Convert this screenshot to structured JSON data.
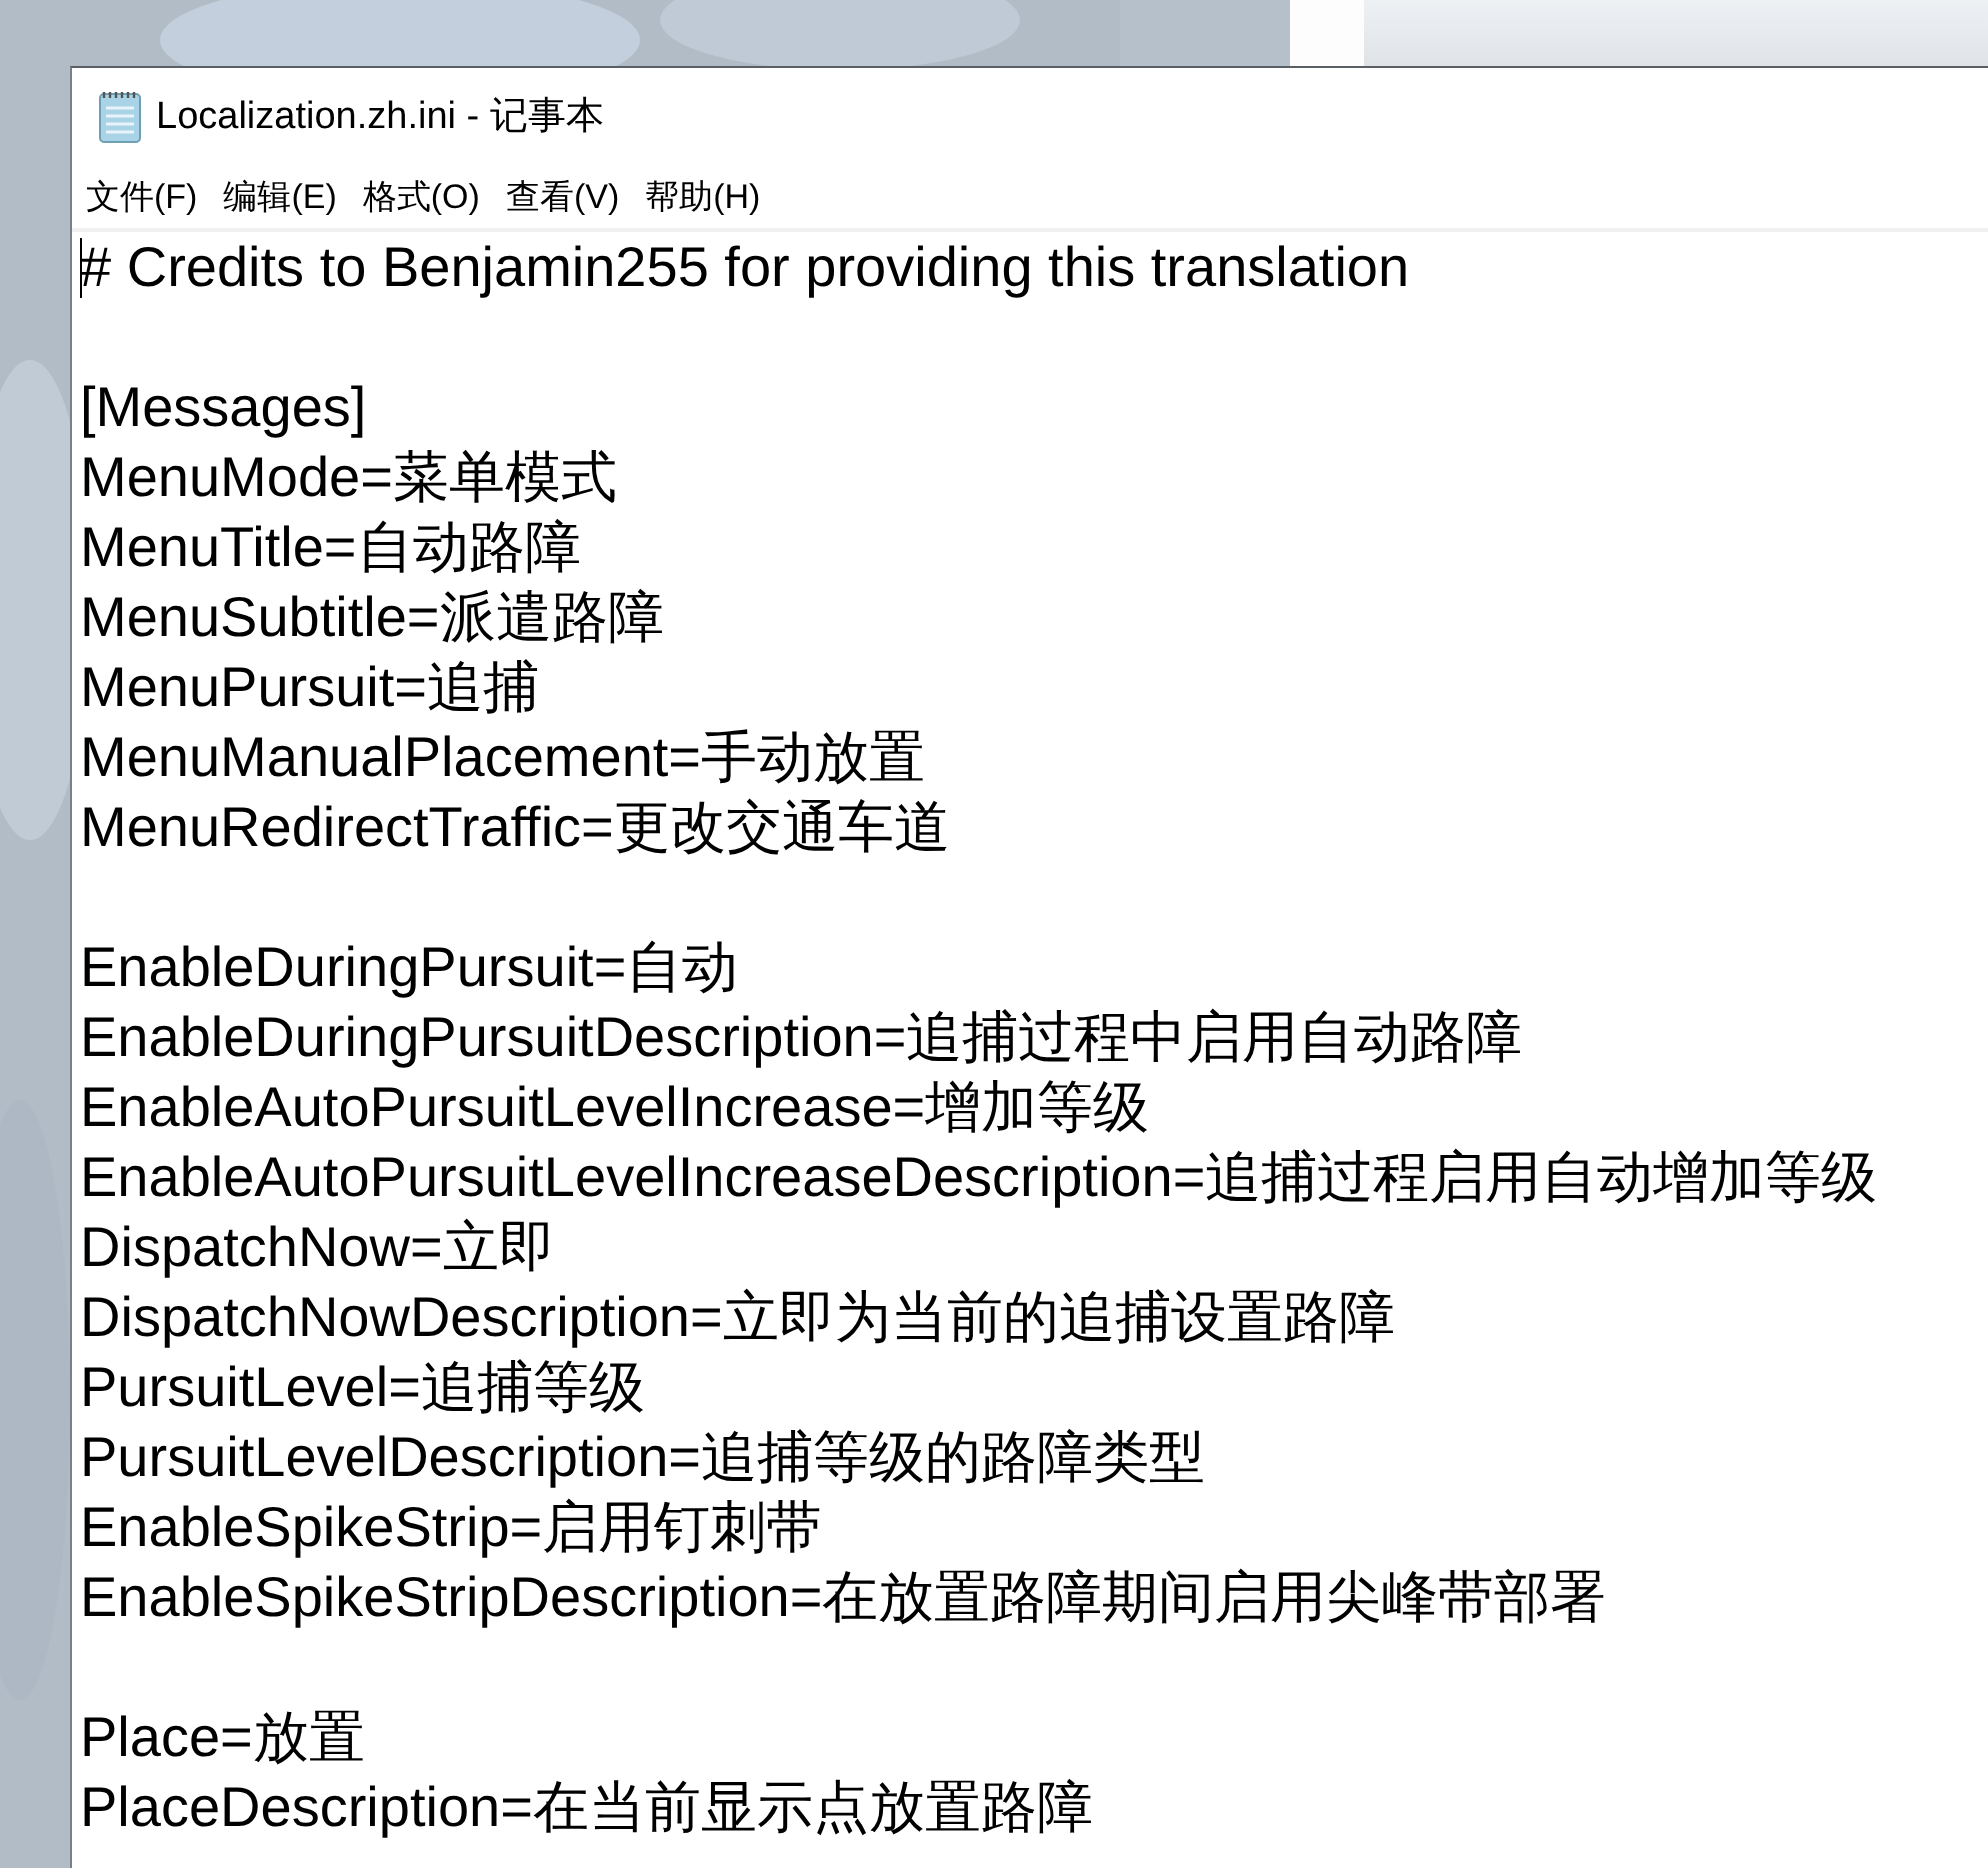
{
  "window": {
    "title": "Localization.zh.ini - 记事本"
  },
  "menu": [
    {
      "label": "文件(F)"
    },
    {
      "label": "编辑(E)"
    },
    {
      "label": "格式(O)"
    },
    {
      "label": "查看(V)"
    },
    {
      "label": "帮助(H)"
    }
  ],
  "editor": {
    "caret": true,
    "lines": [
      {
        "kind": "text",
        "text": "# Credits to Benjamin255 for providing this translation"
      },
      {
        "kind": "blank"
      },
      {
        "kind": "text",
        "text": "[Messages]"
      },
      {
        "kind": "text",
        "text": "MenuMode=菜单模式"
      },
      {
        "kind": "text",
        "text": "MenuTitle=自动路障"
      },
      {
        "kind": "text",
        "text": "MenuSubtitle=派遣路障"
      },
      {
        "kind": "text",
        "text": "MenuPursuit=追捕"
      },
      {
        "kind": "text",
        "text": "MenuManualPlacement=手动放置"
      },
      {
        "kind": "text",
        "text": "MenuRedirectTraffic=更改交通车道"
      },
      {
        "kind": "blank"
      },
      {
        "kind": "text",
        "text": "EnableDuringPursuit=自动"
      },
      {
        "kind": "text",
        "text": "EnableDuringPursuitDescription=追捕过程中启用自动路障"
      },
      {
        "kind": "text",
        "text": "EnableAutoPursuitLevelIncrease=增加等级"
      },
      {
        "kind": "text",
        "text": "EnableAutoPursuitLevelIncreaseDescription=追捕过程启用自动增加等级"
      },
      {
        "kind": "text",
        "text": "DispatchNow=立即"
      },
      {
        "kind": "text",
        "text": "DispatchNowDescription=立即为当前的追捕设置路障"
      },
      {
        "kind": "text",
        "text": "PursuitLevel=追捕等级"
      },
      {
        "kind": "text",
        "text": "PursuitLevelDescription=追捕等级的路障类型"
      },
      {
        "kind": "text",
        "text": "EnableSpikeStrip=启用钉刺带"
      },
      {
        "kind": "text",
        "text": "EnableSpikeStripDescription=在放置路障期间启用尖峰带部署"
      },
      {
        "kind": "blank"
      },
      {
        "kind": "text",
        "text": "Place=放置"
      },
      {
        "kind": "text",
        "text": "PlaceDescription=在当前显示点放置路障"
      }
    ]
  }
}
